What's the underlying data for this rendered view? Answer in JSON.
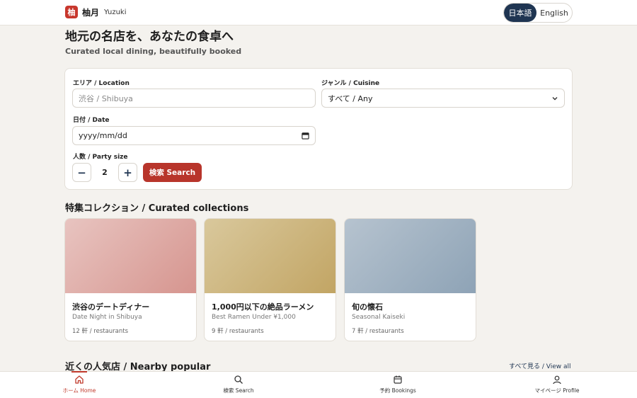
{
  "header": {
    "logo_char": "柚",
    "brand_name": "柚月",
    "brand_roman": "Yuzuki",
    "lang_ja": "日本語",
    "lang_en": "English"
  },
  "hero": {
    "title": "地元の名店を、あなたの食卓へ",
    "subtitle": "Curated local dining, beautifully booked"
  },
  "search": {
    "location_label": "エリア / Location",
    "location_placeholder": "渋谷 / Shibuya",
    "cuisine_label": "ジャンル / Cuisine",
    "cuisine_value": "すべて / Any",
    "date_label": "日付 / Date",
    "date_value": "yyyy/mm/dd",
    "party_label": "人数 / Party size",
    "party_minus": "−",
    "party_value": "2",
    "party_plus": "+",
    "search_button": "検索 Search"
  },
  "collections": {
    "title": "特集コレクション / Curated collections",
    "items": [
      {
        "title": "渋谷のデートディナー",
        "subtitle": "Date Night in Shibuya",
        "count": "12 軒 / restaurants",
        "color_a": "#e8c4c0",
        "color_b": "#d6958f"
      },
      {
        "title": "1,000円以下の絶品ラーメン",
        "subtitle": "Best Ramen Under ¥1,000",
        "count": "9 軒 / restaurants",
        "color_a": "#d9c89c",
        "color_b": "#c2a564"
      },
      {
        "title": "旬の懐石",
        "subtitle": "Seasonal Kaiseki",
        "count": "7 軒 / restaurants",
        "color_a": "#b6c3cf",
        "color_b": "#8ea3b6"
      }
    ]
  },
  "nearby": {
    "title": "近くの人気店 / Nearby popular",
    "view_all": "すべて見る / View all"
  },
  "nav": {
    "home": "ホーム Home",
    "search": "検索 Search",
    "bookings": "予約 Bookings",
    "profile": "マイページ Profile"
  },
  "colors": {
    "accent": "#c0392b",
    "navy": "#1f3552",
    "background": "#f4f2ee"
  }
}
